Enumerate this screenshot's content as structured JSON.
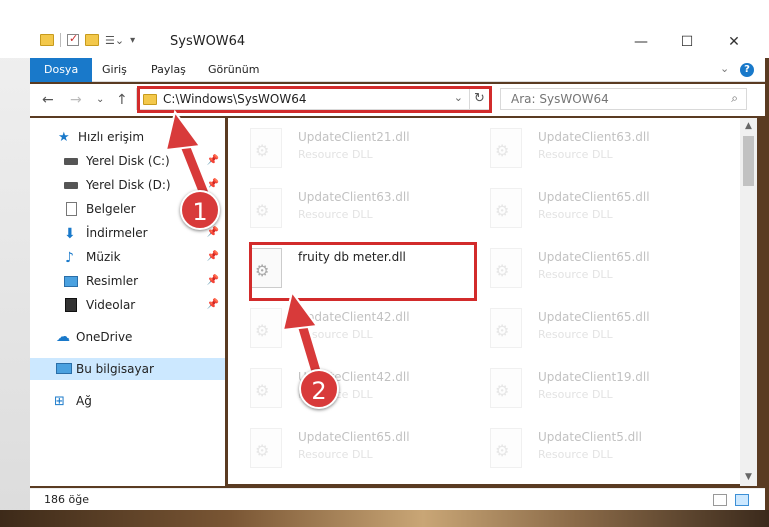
{
  "window": {
    "title": "SysWOW64",
    "minimize": "—",
    "maximize": "☐",
    "close": "✕"
  },
  "ribbon": {
    "tabs": [
      "Dosya",
      "Giriş",
      "Paylaş",
      "Görünüm"
    ],
    "collapse": "⌄",
    "help": "?"
  },
  "nav": {
    "back": "←",
    "forward": "→",
    "recent": "⌄",
    "up": "↑",
    "address": "C:\\Windows\\SysWOW64",
    "address_dropdown": "⌄",
    "refresh": "↻",
    "search_placeholder": "Ara: SysWOW64",
    "search_icon": "⌕"
  },
  "navpane": {
    "items": [
      {
        "label": "Hızlı erişim",
        "icon": "star-icon",
        "pinned": false
      },
      {
        "label": "Yerel Disk (C:)",
        "icon": "drive-icon",
        "pinned": true
      },
      {
        "label": "Yerel Disk (D:)",
        "icon": "drive-icon",
        "pinned": true
      },
      {
        "label": "Belgeler",
        "icon": "document-icon",
        "pinned": true
      },
      {
        "label": "İndirmeler",
        "icon": "download-icon",
        "pinned": true
      },
      {
        "label": "Müzik",
        "icon": "music-icon",
        "pinned": true
      },
      {
        "label": "Resimler",
        "icon": "pictures-icon",
        "pinned": true
      },
      {
        "label": "Videolar",
        "icon": "video-icon",
        "pinned": true
      },
      {
        "label": "OneDrive",
        "icon": "cloud-icon",
        "pinned": false
      },
      {
        "label": "Bu bilgisayar",
        "icon": "computer-icon",
        "pinned": false,
        "selected": true
      },
      {
        "label": "Ağ",
        "icon": "network-icon",
        "pinned": false
      }
    ],
    "pin_glyph": "📌"
  },
  "files": {
    "highlighted": {
      "name": "fruity db meter.dll"
    },
    "col1": [
      {
        "name": "UpdateClient21.dll",
        "desc": "Resource DLL"
      },
      {
        "name": "UpdateClient63.dll",
        "desc": "Resource DLL"
      },
      {
        "name": "fruity db meter.dll",
        "desc": ""
      },
      {
        "name": "UpdateClient42.dll",
        "desc": "Resource DLL"
      },
      {
        "name": "UpdateClient42.dll",
        "desc": "Resource DLL"
      },
      {
        "name": "UpdateClient65.dll",
        "desc": "Resource DLL"
      }
    ],
    "col2": [
      {
        "name": "UpdateClient63.dll",
        "desc": "Resource DLL"
      },
      {
        "name": "UpdateClient65.dll",
        "desc": "Resource DLL"
      },
      {
        "name": "UpdateClient65.dll",
        "desc": "Resource DLL"
      },
      {
        "name": "UpdateClient65.dll",
        "desc": "Resource DLL"
      },
      {
        "name": "UpdateClient19.dll",
        "desc": "Resource DLL"
      },
      {
        "name": "UpdateClient5.dll",
        "desc": "Resource DLL"
      }
    ]
  },
  "status": {
    "count": "186 öğe"
  },
  "annotations": {
    "badge1": "1",
    "badge2": "2",
    "color": "#d22b2b"
  }
}
